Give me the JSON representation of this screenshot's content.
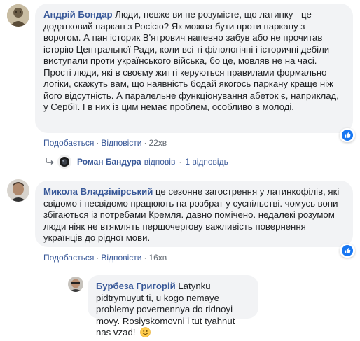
{
  "comments": [
    {
      "author": "Андрій Бондар",
      "text": "Люди, невже ви не розумієте, що латинку - це додатковий паркан з Росією? Як можна бути проти паркану з ворогом. А пан історик В'ятрович напевно забув або не прочитав історію Центральної Ради, коли всі ті філологічні і історичні дебіли виступали проти українського війська, бо це, мовляв не на часі. Прості люди, які в своєму житті керуються правилами формально логіки, скажуть вам, що наявність бодай якогось паркану краще ніж його відсутність. А паралельне функціонування абеток є, наприклад, у Сербії. І в них із цим немає проблем, особливо в молоді.",
      "like_label": "Подобається",
      "reply_label": "Відповісти",
      "time": "22хв",
      "reaction_icon": "like-icon"
    },
    {
      "author": "Микола Владзімірський",
      "text": "це сезонне загострення у латинкофілів, які свідомо і несвідомо працюють на розбрат у суспільстві. чомусь вони збігаються із потребами Кремля. давно помічено. недалекі розумом люди ніяк не втямлять першочергову важливість повернення українців до рідної мови.",
      "like_label": "Подобається",
      "reply_label": "Відповісти",
      "time": "16хв",
      "reaction_icon": "like-icon"
    }
  ],
  "reply_summary": {
    "name": "Роман Бандура",
    "verb": "відповів",
    "count": "1 відповідь"
  },
  "reply": {
    "author": "Бурбеза Григорій",
    "text": "Latynku pidtrymuyut ti, u kogo nemaye problemy povernennya do ridnoyi movy. Rosiyskomovni i tut tyahnut nas vzad!",
    "emoji": "smile-emoji-icon"
  },
  "colors": {
    "link": "#385898",
    "bubble": "#f2f3f5",
    "like_blue": "#1877f2",
    "meta": "#606770"
  }
}
